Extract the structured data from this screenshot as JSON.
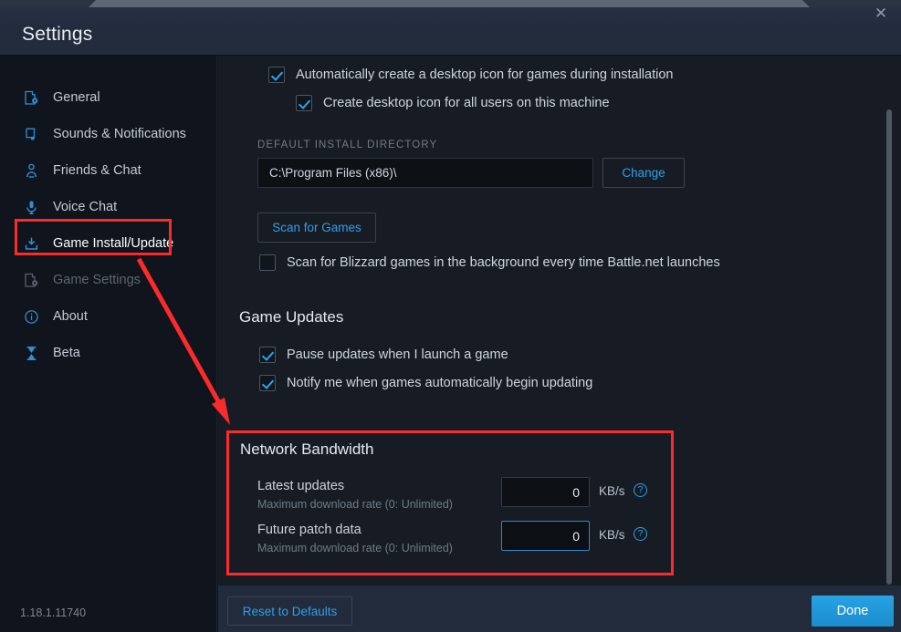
{
  "window": {
    "title": "Settings",
    "close_label": "✕",
    "version": "1.18.1.11740"
  },
  "sidebar": {
    "items": [
      {
        "label": "General",
        "icon": "general-gear-icon",
        "state": "normal"
      },
      {
        "label": "Sounds & Notifications",
        "icon": "sound-note-icon",
        "state": "normal"
      },
      {
        "label": "Friends & Chat",
        "icon": "friends-person-icon",
        "state": "normal"
      },
      {
        "label": "Voice Chat",
        "icon": "microphone-icon",
        "state": "normal"
      },
      {
        "label": "Game Install/Update",
        "icon": "download-icon",
        "state": "active"
      },
      {
        "label": "Game Settings",
        "icon": "game-settings-icon",
        "state": "disabled"
      },
      {
        "label": "About",
        "icon": "info-circle-icon",
        "state": "normal"
      },
      {
        "label": "Beta",
        "icon": "beta-flask-icon",
        "state": "normal"
      }
    ]
  },
  "main": {
    "desktop_icon_checkbox": {
      "label": "Automatically create a desktop icon for games during installation",
      "checked": true
    },
    "all_users_checkbox": {
      "label": "Create desktop icon for all users on this machine",
      "checked": true
    },
    "install_directory": {
      "label": "DEFAULT INSTALL DIRECTORY",
      "value": "C:\\Program Files (x86)\\",
      "change_button": "Change"
    },
    "scan_button": "Scan for Games",
    "background_scan_checkbox": {
      "label": "Scan for Blizzard games in the background every time Battle.net launches",
      "checked": false
    },
    "game_updates": {
      "title": "Game Updates",
      "pause_checkbox": {
        "label": "Pause updates when I launch a game",
        "checked": true
      },
      "notify_checkbox": {
        "label": "Notify me when games automatically begin updating",
        "checked": true
      }
    },
    "network_bandwidth": {
      "title": "Network Bandwidth",
      "rows": [
        {
          "name": "Latest updates",
          "sub": "Maximum download rate (0: Unlimited)",
          "value": "0",
          "unit": "KB/s",
          "help": "?",
          "focused": false
        },
        {
          "name": "Future patch data",
          "sub": "Maximum download rate (0: Unlimited)",
          "value": "0",
          "unit": "KB/s",
          "help": "?",
          "focused": true
        }
      ]
    }
  },
  "footer": {
    "reset_label": "Reset to Defaults",
    "done_label": "Done"
  },
  "colors": {
    "accent": "#2f9fe8",
    "annotation": "#fc2b2b",
    "sidebar_bg": "#10141c",
    "content_bg": "#171c24",
    "header_bg": "#232c3d"
  }
}
